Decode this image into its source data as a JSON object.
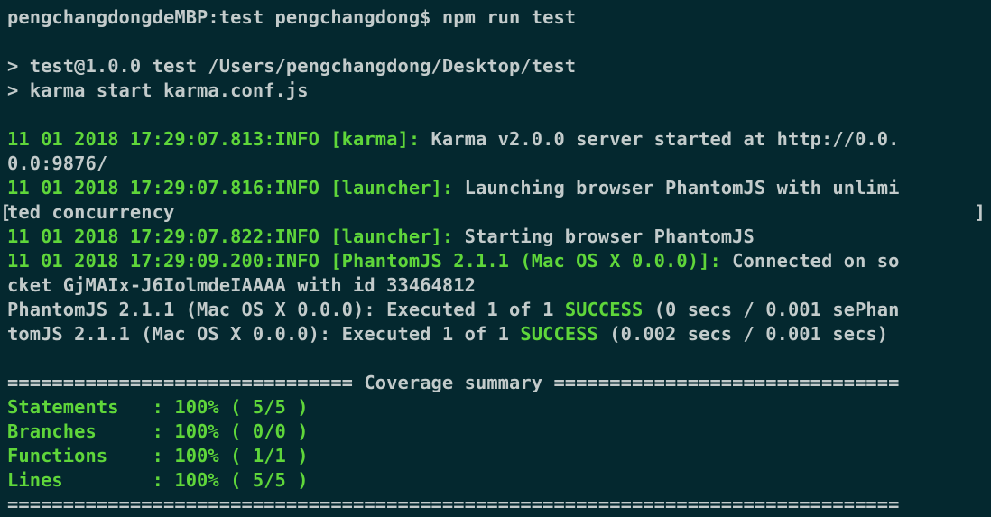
{
  "colors": {
    "background": "#04282f",
    "text": "#c3cbcb",
    "green": "#5fd63a"
  },
  "lines": [
    [
      {
        "t": "pengchangdongdeMBP:test pengchangdong$ npm run test",
        "c": "w"
      }
    ],
    [],
    [
      {
        "t": "> test@1.0.0 test /Users/pengchangdong/Desktop/test",
        "c": "w"
      }
    ],
    [
      {
        "t": "> karma start karma.conf.js",
        "c": "w"
      }
    ],
    [],
    [
      {
        "t": "11 01 2018 17:29:07.813:INFO [karma]:",
        "c": "g"
      },
      {
        "t": " Karma v2.0.0 server started at http://0.0.",
        "c": "w"
      }
    ],
    [
      {
        "t": "0.0:9876/",
        "c": "w"
      }
    ],
    [
      {
        "t": "11 01 2018 17:29:07.816:INFO [launcher]:",
        "c": "g"
      },
      {
        "t": " Launching browser PhantomJS with unlimi",
        "c": "w"
      }
    ],
    [
      {
        "t": "ted concurrency",
        "c": "w"
      }
    ],
    [
      {
        "t": "11 01 2018 17:29:07.822:INFO [launcher]:",
        "c": "g"
      },
      {
        "t": " Starting browser PhantomJS",
        "c": "w"
      }
    ],
    [
      {
        "t": "11 01 2018 17:29:09.200:INFO [PhantomJS 2.1.1 (Mac OS X 0.0.0)]:",
        "c": "g"
      },
      {
        "t": " Connected on so",
        "c": "w"
      }
    ],
    [
      {
        "t": "cket GjMAIx-J6IolmdeIAAAA with id 33464812",
        "c": "w"
      }
    ],
    [
      {
        "t": "PhantomJS 2.1.1 (Mac OS X 0.0.0): Executed 1 of 1 ",
        "c": "w"
      },
      {
        "t": "SUCCESS",
        "c": "g"
      },
      {
        "t": " (0 secs / 0.001 sePhan",
        "c": "w"
      }
    ],
    [
      {
        "t": "tomJS 2.1.1 (Mac OS X 0.0.0): Executed 1 of 1 ",
        "c": "w"
      },
      {
        "t": "SUCCESS",
        "c": "g"
      },
      {
        "t": " (0.002 secs / 0.001 secs)",
        "c": "w"
      }
    ],
    [],
    [
      {
        "t": "=============================== Coverage summary ===============================",
        "c": "w"
      }
    ],
    [
      {
        "t": "Statements   : 100% ( 5/5 )",
        "c": "g"
      }
    ],
    [
      {
        "t": "Branches     : 100% ( 0/0 )",
        "c": "g"
      }
    ],
    [
      {
        "t": "Functions    : 100% ( 1/1 )",
        "c": "g"
      }
    ],
    [
      {
        "t": "Lines        : 100% ( 5/5 )",
        "c": "g"
      }
    ],
    [
      {
        "t": "================================================================================",
        "c": "w"
      }
    ]
  ],
  "wrap_marker": {
    "line_index": 8,
    "left": "[",
    "right": "]"
  }
}
